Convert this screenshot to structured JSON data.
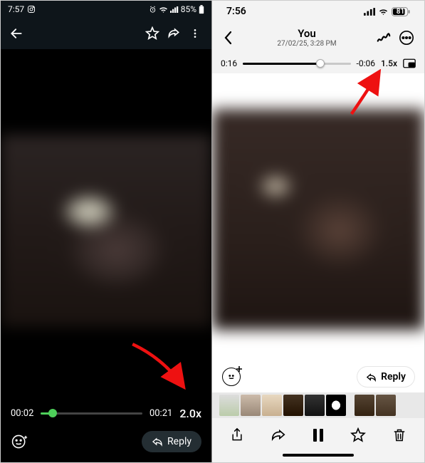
{
  "left": {
    "status": {
      "time": "7:57",
      "battery": "85%"
    },
    "progress": {
      "current": "00:02",
      "total": "00:21",
      "speed": "2.0x"
    },
    "reply_label": "Reply"
  },
  "right": {
    "status": {
      "time": "7:56",
      "battery": "81"
    },
    "header": {
      "title": "You",
      "subtitle": "27/02/25, 3:28 PM"
    },
    "progress": {
      "current": "0:16",
      "remaining": "-0:06",
      "speed": "1.5x"
    },
    "reply_label": "Reply"
  }
}
